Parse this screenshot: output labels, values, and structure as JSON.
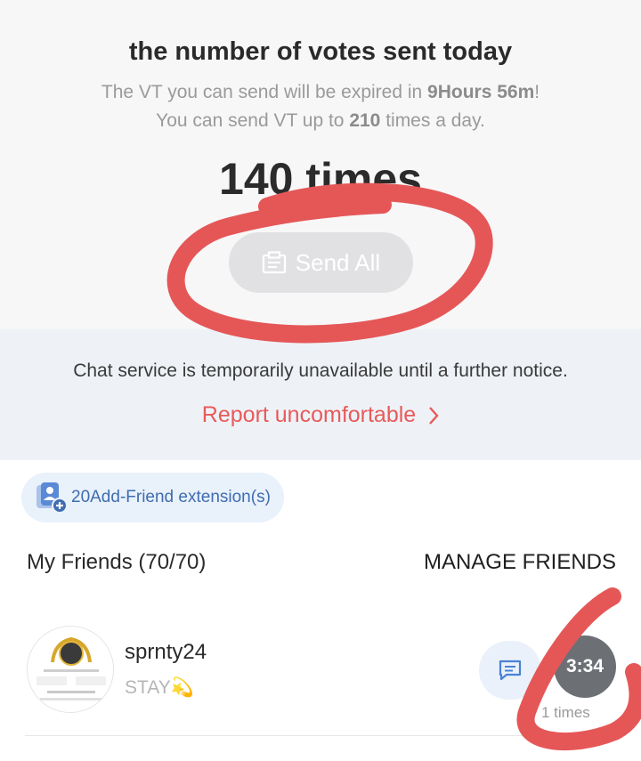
{
  "votes": {
    "title": "the number of votes sent today",
    "expire_prefix": "The VT you can send will be expired in ",
    "expire_value": "9Hours 56m",
    "expire_suffix": "!",
    "limit_prefix": "You can send VT up to ",
    "limit_value": "210",
    "limit_suffix": " times a day.",
    "count": "140 times",
    "send_all_label": "Send All"
  },
  "notice": {
    "text": "Chat service is temporarily unavailable until a further notice.",
    "report_label": "Report uncomfortable"
  },
  "extension": {
    "label": "20Add-Friend extension(s)"
  },
  "friends": {
    "title": "My Friends  (70/70)",
    "manage_label": "MANAGE FRIENDS",
    "items": [
      {
        "name": "sprnty24",
        "status": "STAY💫",
        "timer": "3:34",
        "times": "1 times"
      }
    ]
  },
  "colors": {
    "accent_red": "#e85a5a",
    "link_blue": "#3f6db0",
    "annotation_red": "#e55757"
  },
  "icons": [
    "send-all-icon",
    "chevron-right-icon",
    "add-friend-icon",
    "chat-icon"
  ]
}
